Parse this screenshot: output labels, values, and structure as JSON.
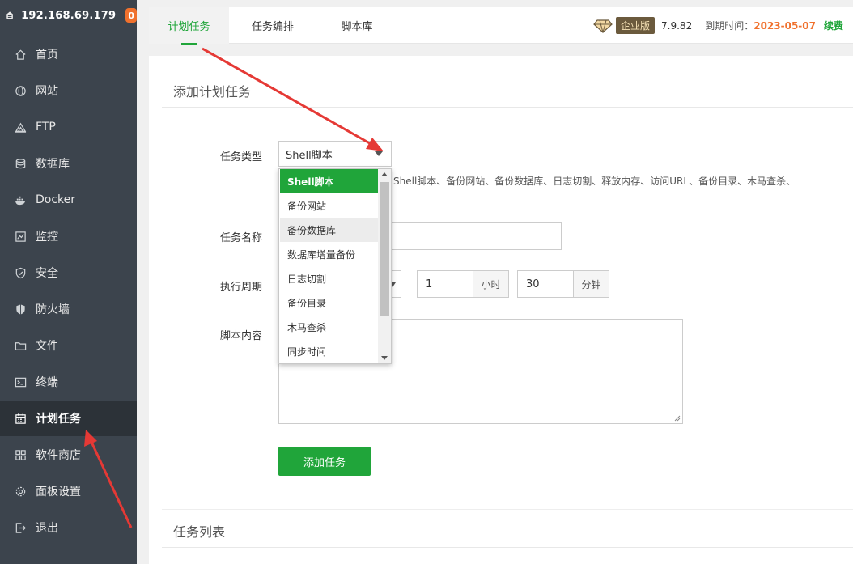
{
  "server": {
    "ip": "192.168.69.179",
    "badge": "0"
  },
  "sidebar": {
    "items": [
      {
        "label": "首页",
        "icon": "home-icon"
      },
      {
        "label": "网站",
        "icon": "globe-icon"
      },
      {
        "label": "FTP",
        "icon": "ftp-icon"
      },
      {
        "label": "数据库",
        "icon": "database-icon"
      },
      {
        "label": "Docker",
        "icon": "docker-icon"
      },
      {
        "label": "监控",
        "icon": "monitor-icon"
      },
      {
        "label": "安全",
        "icon": "shield-icon"
      },
      {
        "label": "防火墙",
        "icon": "firewall-icon"
      },
      {
        "label": "文件",
        "icon": "folder-icon"
      },
      {
        "label": "终端",
        "icon": "terminal-icon"
      },
      {
        "label": "计划任务",
        "icon": "calendar-icon",
        "active": true
      },
      {
        "label": "软件商店",
        "icon": "apps-icon"
      },
      {
        "label": "面板设置",
        "icon": "gear-icon"
      },
      {
        "label": "退出",
        "icon": "logout-icon"
      }
    ]
  },
  "tabs": [
    {
      "label": "计划任务",
      "active": true
    },
    {
      "label": "任务编排"
    },
    {
      "label": "脚本库"
    }
  ],
  "edition": {
    "icon": "diamond-icon",
    "tag": "企业版",
    "version": "7.9.82",
    "expire_label": "到期时间：",
    "expire_date": "2023-05-07",
    "renew": "续费"
  },
  "form": {
    "section_title": "添加计划任务",
    "task_type_label": "任务类型",
    "task_type_value": "Shell脚本",
    "task_type_hint": "Shell脚本、备份网站、备份数据库、日志切割、释放内存、访问URL、备份目录、木马查杀、",
    "task_name_label": "任务名称",
    "task_name_value": "",
    "period_label": "执行周期",
    "hours_value": "1",
    "hours_unit": "小时",
    "minutes_value": "30",
    "minutes_unit": "分钟",
    "script_label": "脚本内容",
    "script_value": "",
    "submit_label": "添加任务"
  },
  "dropdown": {
    "options": [
      "Shell脚本",
      "备份网站",
      "备份数据库",
      "数据库增量备份",
      "日志切割",
      "备份目录",
      "木马查杀",
      "同步时间"
    ],
    "selected_index": 0,
    "hover_index": 2
  },
  "list_section_title": "任务列表",
  "colors": {
    "accent": "#20a53a",
    "sidebar": "#3c444d",
    "badge": "#f0712d",
    "annotation": "#e53935"
  }
}
